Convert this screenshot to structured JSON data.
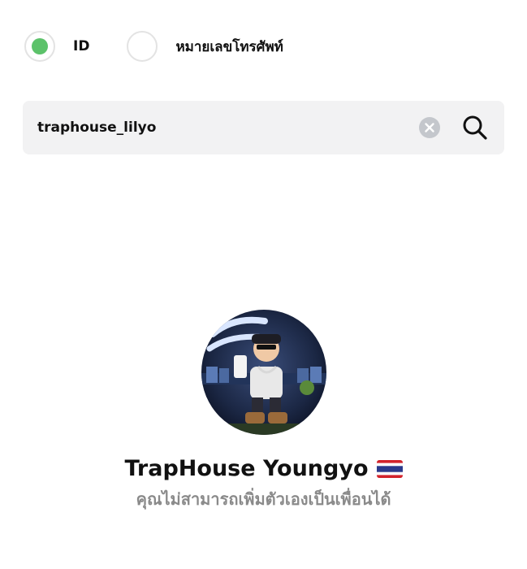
{
  "search_type": {
    "options": [
      {
        "label": "ID",
        "selected": true
      },
      {
        "label": "หมายเลขโทรศัพท์",
        "selected": false
      }
    ],
    "selected_color": "#5cc26a"
  },
  "search": {
    "value": "traphouse_lilyo",
    "clear_icon": "clear-circle-icon",
    "search_icon": "magnifier-icon"
  },
  "profile": {
    "name": "TrapHouse Youngyo",
    "flag": "thailand-flag",
    "note": "คุณไม่สามารถเพิ่มตัวเองเป็นเพื่อนได้"
  }
}
